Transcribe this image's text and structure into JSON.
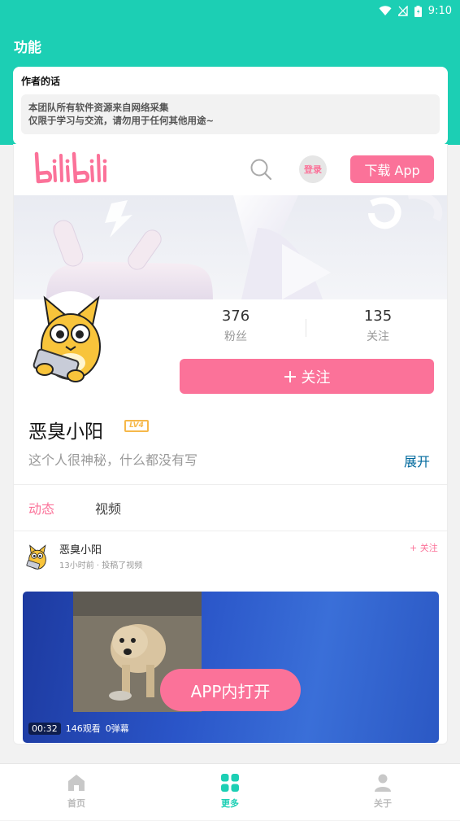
{
  "statusbar": {
    "time": "9:10"
  },
  "header": {
    "title": "功能"
  },
  "author_card": {
    "title": "作者的话",
    "line1": "本团队所有软件资源来自网络采集",
    "line2": "仅限于学习与交流，请勿用于任何其他用途~"
  },
  "bili": {
    "login_label": "登录",
    "download_label": "下载 App"
  },
  "profile": {
    "fans_count": "376",
    "fans_label": "粉丝",
    "following_count": "135",
    "following_label": "关注",
    "follow_button": "关注",
    "username": "恶臭小阳",
    "level": "LV4",
    "bio": "这个人很神秘，什么都没有写",
    "expand_label": "展开"
  },
  "tabs": [
    {
      "label": "动态"
    },
    {
      "label": "视频"
    }
  ],
  "post": {
    "user": "恶臭小阳",
    "meta": "13小时前 · 投稿了视频",
    "follow_label": "+ 关注",
    "open_app_label": "APP内打开",
    "duration": "00:32",
    "views": "146观看",
    "danmaku": "0弹幕"
  },
  "bottom_nav": [
    {
      "label": "首页",
      "icon": "home-icon"
    },
    {
      "label": "更多",
      "icon": "grid-icon"
    },
    {
      "label": "关于",
      "icon": "person-icon"
    }
  ],
  "colors": {
    "accent": "#1ccfb4",
    "pink": "#fb7299",
    "link": "#00699d"
  }
}
